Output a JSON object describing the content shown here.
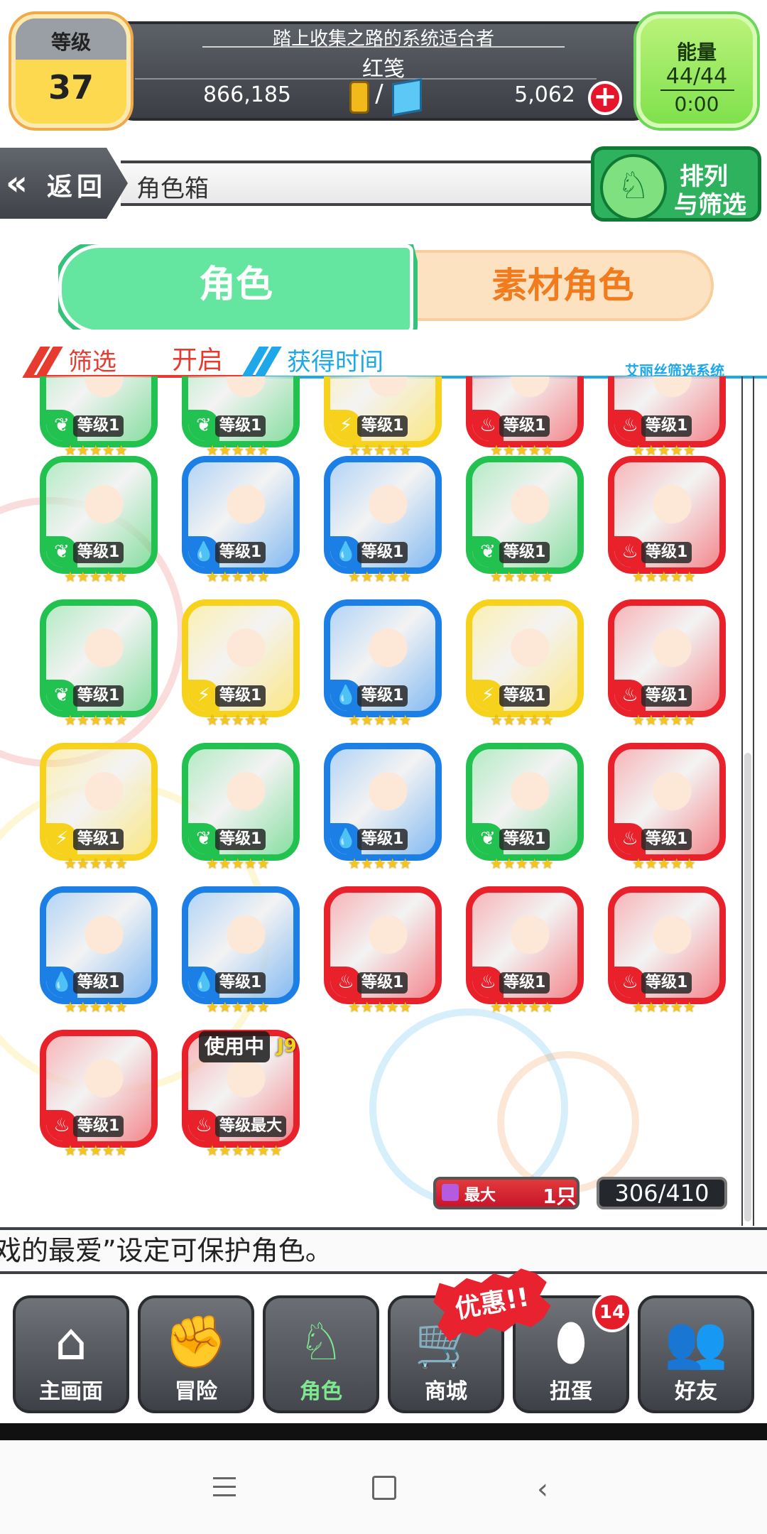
{
  "header": {
    "level_label": "等级",
    "level_value": "37",
    "title": "踏上收集之路的系统适合者",
    "player_name": "红笺",
    "gold": "866,185",
    "separator": "/",
    "gems": "5,062",
    "energy_label": "能量",
    "energy_value": "44/44",
    "energy_timer": "0:00"
  },
  "nav": {
    "back_label": "返回",
    "page_title": "角色箱",
    "sort_line1": "排列",
    "sort_line2": "与筛选"
  },
  "tabs": [
    {
      "label": "角色",
      "active": true
    },
    {
      "label": "素材角色",
      "active": false
    }
  ],
  "filter": {
    "filter_label": "筛选",
    "filter_state": "开启",
    "sort_label": "获得时间",
    "system_label": "艾丽丝筛选系统"
  },
  "characters": [
    {
      "element": "wood",
      "color": "#21c24f",
      "level": "等级1",
      "stars": "★★★★★"
    },
    {
      "element": "wood",
      "color": "#21c24f",
      "level": "等级1",
      "stars": "★★★★★"
    },
    {
      "element": "light",
      "color": "#f7d21c",
      "level": "等级1",
      "stars": "★★★★★"
    },
    {
      "element": "fire",
      "color": "#e8212b",
      "level": "等级1",
      "stars": "★★★★★"
    },
    {
      "element": "fire",
      "color": "#e8212b",
      "level": "等级1",
      "stars": "★★★★★"
    },
    {
      "element": "wood",
      "color": "#21c24f",
      "level": "等级1",
      "stars": "★★★★★"
    },
    {
      "element": "water",
      "color": "#1b7fe6",
      "level": "等级1",
      "stars": "★★★★★"
    },
    {
      "element": "water",
      "color": "#1b7fe6",
      "level": "等级1",
      "stars": "★★★★★"
    },
    {
      "element": "wood",
      "color": "#21c24f",
      "level": "等级1",
      "stars": "★★★★★"
    },
    {
      "element": "fire",
      "color": "#e8212b",
      "level": "等级1",
      "stars": "★★★★★"
    },
    {
      "element": "wood",
      "color": "#21c24f",
      "level": "等级1",
      "stars": "★★★★★"
    },
    {
      "element": "light",
      "color": "#f7d21c",
      "level": "等级1",
      "stars": "★★★★★"
    },
    {
      "element": "water",
      "color": "#1b7fe6",
      "level": "等级1",
      "stars": "★★★★★"
    },
    {
      "element": "light",
      "color": "#f7d21c",
      "level": "等级1",
      "stars": "★★★★★"
    },
    {
      "element": "fire",
      "color": "#e8212b",
      "level": "等级1",
      "stars": "★★★★★"
    },
    {
      "element": "light",
      "color": "#f7d21c",
      "level": "等级1",
      "stars": "★★★★★"
    },
    {
      "element": "wood",
      "color": "#21c24f",
      "level": "等级1",
      "stars": "★★★★★"
    },
    {
      "element": "water",
      "color": "#1b7fe6",
      "level": "等级1",
      "stars": "★★★★★"
    },
    {
      "element": "wood",
      "color": "#21c24f",
      "level": "等级1",
      "stars": "★★★★★"
    },
    {
      "element": "fire",
      "color": "#e8212b",
      "level": "等级1",
      "stars": "★★★★★"
    },
    {
      "element": "water",
      "color": "#1b7fe6",
      "level": "等级1",
      "stars": "★★★★★"
    },
    {
      "element": "water",
      "color": "#1b7fe6",
      "level": "等级1",
      "stars": "★★★★★"
    },
    {
      "element": "fire",
      "color": "#e8212b",
      "level": "等级1",
      "stars": "★★★★★"
    },
    {
      "element": "fire",
      "color": "#e8212b",
      "level": "等级1",
      "stars": "★★★★★"
    },
    {
      "element": "fire",
      "color": "#e8212b",
      "level": "等级1",
      "stars": "★★★★★"
    },
    {
      "element": "fire",
      "color": "#e8212b",
      "level": "等级1",
      "stars": "★★★★★"
    },
    {
      "element": "fire",
      "color": "#e8212b",
      "level": "等级最大",
      "stars": "★★★★★★",
      "badge": "使用中",
      "corner": "J9"
    }
  ],
  "counters": {
    "max_label": "最大",
    "max_count": "1只",
    "box_count": "306/410"
  },
  "ticker": "戏的最爱”设定可保护角色。",
  "bottom_nav": [
    {
      "label": "主画面",
      "icon": "home-icon",
      "glyph": "⌂"
    },
    {
      "label": "冒险",
      "icon": "handshake-icon",
      "glyph": "✊"
    },
    {
      "label": "角色",
      "icon": "rabbit-icon",
      "glyph": "♘",
      "active": true
    },
    {
      "label": "商城",
      "icon": "cart-icon",
      "glyph": "🛒"
    },
    {
      "label": "扭蛋",
      "icon": "egg-icon",
      "glyph": "⬮"
    },
    {
      "label": "好友",
      "icon": "friends-icon",
      "glyph": "👥"
    }
  ],
  "promo_label": "优惠!!",
  "notification_count": "14",
  "colors": {
    "accent_green": "#64e6a1",
    "fire": "#e8212b",
    "water": "#1b7fe6",
    "wood": "#21c24f",
    "light": "#f7d21c"
  }
}
